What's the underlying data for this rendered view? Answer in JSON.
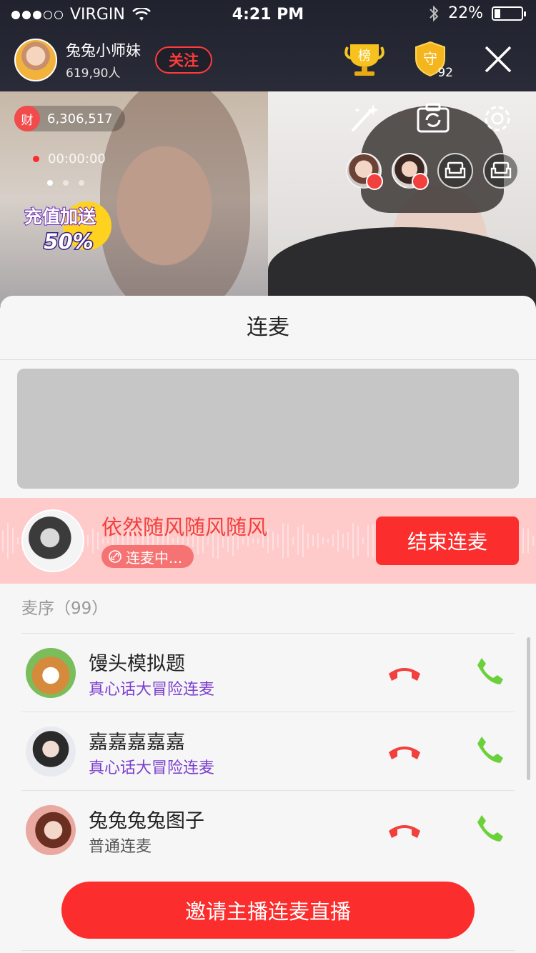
{
  "status_bar": {
    "carrier": "VIRGIN",
    "time": "4:21 PM",
    "battery": "22%",
    "battery_level": 0.22,
    "signal_bars": 3
  },
  "host": {
    "name": "兔兔小师妹",
    "viewers": "619,90人",
    "follow_label": "关注"
  },
  "badges": {
    "rank_label": "榜",
    "guard_label": "守",
    "guard_count": "92"
  },
  "video": {
    "wealth_label": "财",
    "wealth_value": "6,306,517",
    "record_time": "00:00:00",
    "promo_line1": "充值加送",
    "promo_line2": "50%"
  },
  "sheet": {
    "title": "连麦",
    "active": {
      "name": "依然随风随风随风",
      "status": "连麦中...",
      "end_label": "结束连麦"
    },
    "queue_header": "麦序（99）",
    "queue": [
      {
        "name": "馒头模拟题",
        "type": "真心话大冒险连麦",
        "type_style": "purple"
      },
      {
        "name": "嘉嘉嘉嘉嘉",
        "type": "真心话大冒险连麦",
        "type_style": "purple"
      },
      {
        "name": "兔兔兔兔图子",
        "type": "普通连麦",
        "type_style": "gray"
      }
    ],
    "invite_label": "邀请主播连麦直播"
  },
  "colors": {
    "accent": "#fb2d2d",
    "accent_soft": "#ffcaca",
    "purple": "#7b3fcf",
    "accept_green": "#6bd13b"
  }
}
